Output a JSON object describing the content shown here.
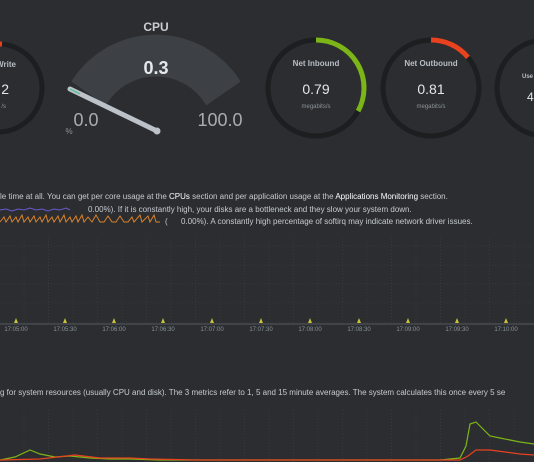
{
  "gauges": {
    "disk_write": {
      "title": "Write",
      "value": "2",
      "unit": "/s"
    },
    "cpu": {
      "title": "CPU",
      "value": "0.3",
      "min": "0.0",
      "max": "100.0",
      "unit": "%"
    },
    "net_inbound": {
      "title": "Net Inbound",
      "value": "0.79",
      "unit": "megabits/s",
      "fill_fraction": 0.33,
      "color": "#7cb518"
    },
    "net_outbound": {
      "title": "Net Outbound",
      "value": "0.81",
      "unit": "megabits/s",
      "fill_fraction": 0.14,
      "color": "#e8421f"
    },
    "used": {
      "title": "Use",
      "value": "4"
    }
  },
  "cpu_section": {
    "line1_prefix": "le time at all. You can get per core usage at the ",
    "line1_link1": "CPUs",
    "line1_mid": " section and per application usage at the ",
    "line1_link2": "Applications Monitoring",
    "line1_suffix": " section.",
    "line2": "0.00%). If it is constantly high, your disks are a bottleneck and they slow your system down.",
    "line3": "0.00%). A constantly high percentage of softirq may indicate network driver issues."
  },
  "cpu_chart_times": [
    "17:05:00",
    "17:05:30",
    "17:06:00",
    "17:06:30",
    "17:07:00",
    "17:07:30",
    "17:08:00",
    "17:08:30",
    "17:09:00",
    "17:09:30",
    "17:10:00"
  ],
  "load_section": {
    "text": "g for system resources (usually CPU and disk). The 3 metrics refer to 1, 5 and 15 minute averages. The system calculates this once every 5 se"
  },
  "colors": {
    "background": "#2b2d30",
    "gauge_track": "#3b3e43",
    "inbound": "#7cb518",
    "outbound": "#e8421f",
    "load1": "#7cb518",
    "load5": "#e8421f"
  }
}
